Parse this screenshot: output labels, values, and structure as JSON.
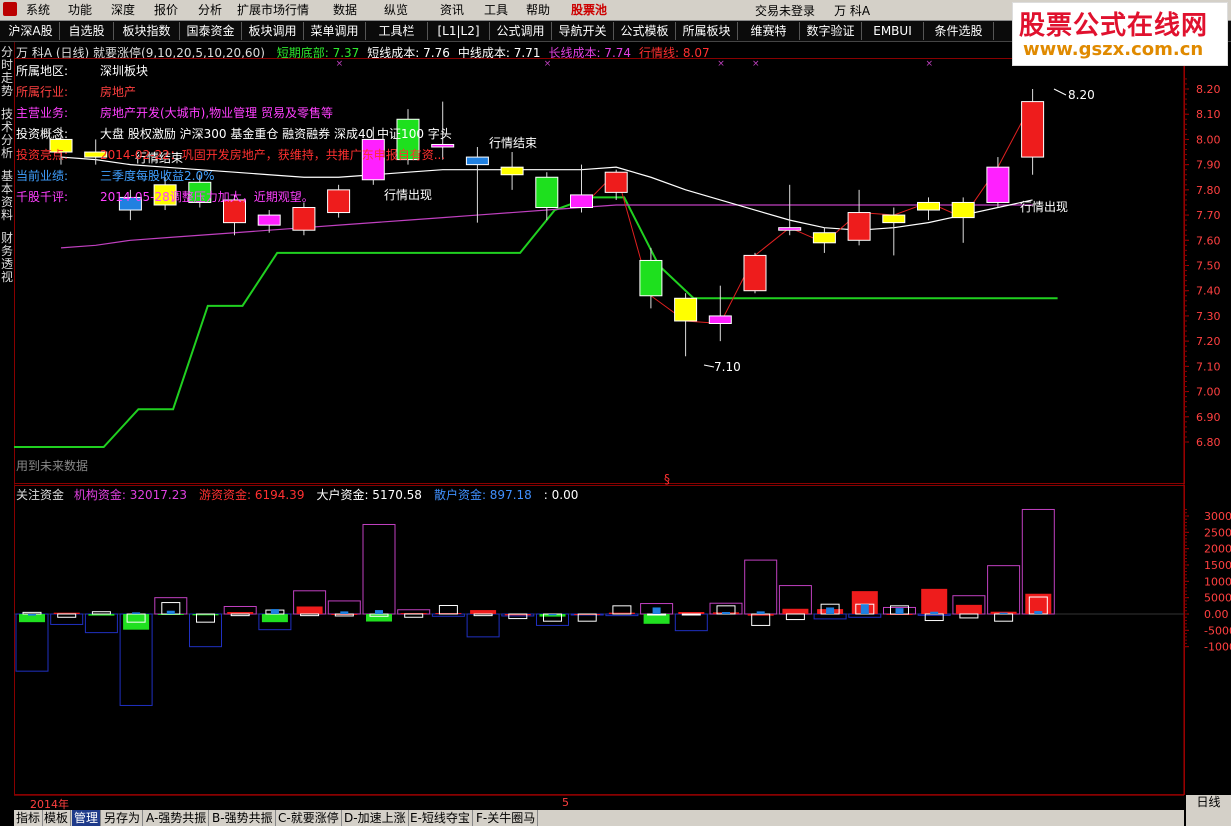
{
  "menubar": {
    "items": [
      "系统",
      "功能",
      "深度",
      "报价",
      "分析",
      "扩展市场行情",
      "数据",
      "纵览",
      "资讯",
      "工具",
      "帮助",
      "股票池"
    ],
    "right": [
      "交易未登录",
      "万 科A"
    ]
  },
  "toolbar": {
    "buttons": [
      "沪深A股",
      "自选股",
      "板块指数",
      "国泰资金",
      "板块调用",
      "菜单调用",
      "工具栏",
      "[L1|L2]",
      "公式调用",
      "导航开关",
      "公式模板",
      "所属板块",
      "维赛特",
      "数字验证",
      "EMBUI",
      "条件选股"
    ]
  },
  "watermark": {
    "line1": "股票公式在线网",
    "line2": "www.gszx.com.cn"
  },
  "sidetabs": [
    "分时走势",
    "技术分析",
    "基本资料",
    "财务透视"
  ],
  "main_header": {
    "stock": "万 科A (日线) 就要涨停(9,10,20,5,10,20,60)",
    "indicators": [
      {
        "label": "短期底部: 7.37",
        "color": "#2ee82e"
      },
      {
        "label": "短线成本: 7.76",
        "color": "#ffffff"
      },
      {
        "label": "中线成本: 7.71",
        "color": "#ffffff"
      },
      {
        "label": "长线成本: 7.74",
        "color": "#e040e0"
      },
      {
        "label": "行情线: 8.07",
        "color": "#ff3030"
      }
    ]
  },
  "info": {
    "rows": [
      {
        "label": "所属地区:",
        "value": "深圳板块",
        "lcolor": "#ffffff",
        "vcolor": "#ffffff"
      },
      {
        "label": "所属行业:",
        "value": "房地产",
        "lcolor": "#ff4040",
        "vcolor": "#ff4040"
      },
      {
        "label": "主营业务:",
        "value": "房地产开发(大城市),物业管理 贸易及零售等",
        "lcolor": "#ff40ff",
        "vcolor": "#ff40ff"
      },
      {
        "label": "投资概念:",
        "value": "大盘 股权激励 沪深300 基金重仓 融资融券 深成40 中证100 字头",
        "lcolor": "#ffffff",
        "vcolor": "#ffffff"
      },
      {
        "label": "投资亮点:",
        "value": "2014-02-22：巩固开发房地产，获维持，共推广东申报自有资...",
        "lcolor": "#ff3030",
        "vcolor": "#ff3030"
      },
      {
        "label": "当前业绩:",
        "value": "三季度每股收益2.0%",
        "lcolor": "#40a0ff",
        "vcolor": "#40a0ff"
      },
      {
        "label": "千股千评:",
        "value": "2014-05-28调整压力加大，近期观望。",
        "lcolor": "#ff40ff",
        "vcolor": "#ff40ff"
      }
    ]
  },
  "annotations": {
    "signal_end_1": "行情结束",
    "signal_end_2": "行情结束",
    "signal_start_1": "行情出现",
    "signal_start_2": "行情出现",
    "high_label": "8.20",
    "low_label": "7.10",
    "future_label": "用到未来数据",
    "dollar": "§"
  },
  "price_axis": [
    "8.20",
    "8.10",
    "8.00",
    "7.90",
    "7.80",
    "7.70",
    "7.60",
    "7.50",
    "7.40",
    "7.30",
    "7.20",
    "7.10",
    "7.00",
    "6.90",
    "6.80"
  ],
  "low_header": {
    "title": "关注资金",
    "items": [
      {
        "label": "机构资金: 32017.23",
        "color": "#e040e0"
      },
      {
        "label": "游资资金: 6194.39",
        "color": "#ff3030"
      },
      {
        "label": "大户资金: 5170.58",
        "color": "#ffffff"
      },
      {
        "label": "散户资金: 897.18",
        "color": "#4090ff"
      },
      {
        "label": ": 0.00",
        "color": "#ffffff"
      }
    ]
  },
  "vol_axis": [
    "30000",
    "25000",
    "20000",
    "15000",
    "10000",
    "5000",
    "0.00",
    "-5000",
    "-10000"
  ],
  "time_axis": {
    "year": "2014年",
    "month": "5"
  },
  "bottom_tabs": [
    "指标",
    "模板",
    "管理",
    "另存为",
    "A-强势共振",
    "B-强势共振",
    "C-就要涨停",
    "D-加速上涨",
    "E-短线夺宝",
    "F-关牛圈马"
  ],
  "period": "日线",
  "colors": {
    "up": "#ff2020",
    "down": "#20e020",
    "ma_white": "#ffffff",
    "ma_magenta": "#c040c0",
    "support": "#20d020",
    "bg": "#000000"
  },
  "chart_data": {
    "type": "candlestick",
    "ylim": [
      6.75,
      8.25
    ],
    "candles": [
      {
        "o": 7.95,
        "c": 8.0,
        "h": 8.05,
        "l": 7.9,
        "col": "yellow"
      },
      {
        "o": 7.93,
        "c": 7.95,
        "h": 8.0,
        "l": 7.9,
        "col": "yellow"
      },
      {
        "o": 7.77,
        "c": 7.72,
        "h": 7.8,
        "l": 7.68,
        "col": "blue"
      },
      {
        "o": 7.82,
        "c": 7.74,
        "h": 7.85,
        "l": 7.72,
        "col": "yellow"
      },
      {
        "o": 7.75,
        "c": 7.83,
        "h": 7.86,
        "l": 7.73,
        "col": "green"
      },
      {
        "o": 7.67,
        "c": 7.76,
        "h": 7.78,
        "l": 7.62,
        "col": "red"
      },
      {
        "o": 7.7,
        "c": 7.66,
        "h": 7.72,
        "l": 7.63,
        "col": "magenta"
      },
      {
        "o": 7.64,
        "c": 7.73,
        "h": 7.75,
        "l": 7.62,
        "col": "red"
      },
      {
        "o": 7.71,
        "c": 7.8,
        "h": 7.82,
        "l": 7.69,
        "col": "red"
      },
      {
        "o": 7.84,
        "c": 8.0,
        "h": 8.05,
        "l": 7.82,
        "col": "magenta"
      },
      {
        "o": 8.08,
        "c": 7.92,
        "h": 8.12,
        "l": 7.9,
        "col": "green"
      },
      {
        "o": 7.97,
        "c": 7.98,
        "h": 8.15,
        "l": 7.92,
        "col": "magenta"
      },
      {
        "o": 7.93,
        "c": 7.9,
        "h": 7.97,
        "l": 7.67,
        "col": "blue"
      },
      {
        "o": 7.86,
        "c": 7.89,
        "h": 7.95,
        "l": 7.8,
        "col": "yellow"
      },
      {
        "o": 7.85,
        "c": 7.73,
        "h": 7.87,
        "l": 7.68,
        "col": "green"
      },
      {
        "o": 7.78,
        "c": 7.73,
        "h": 7.9,
        "l": 7.71,
        "col": "magenta"
      },
      {
        "o": 7.79,
        "c": 7.87,
        "h": 7.88,
        "l": 7.76,
        "col": "red"
      },
      {
        "o": 7.52,
        "c": 7.38,
        "h": 7.57,
        "l": 7.33,
        "col": "green"
      },
      {
        "o": 7.37,
        "c": 7.28,
        "h": 7.39,
        "l": 7.14,
        "col": "yellow"
      },
      {
        "o": 7.3,
        "c": 7.27,
        "h": 7.42,
        "l": 7.2,
        "col": "magenta"
      },
      {
        "o": 7.4,
        "c": 7.54,
        "h": 7.55,
        "l": 7.39,
        "col": "red"
      },
      {
        "o": 7.64,
        "c": 7.65,
        "h": 7.82,
        "l": 7.62,
        "col": "magenta"
      },
      {
        "o": 7.63,
        "c": 7.59,
        "h": 7.65,
        "l": 7.55,
        "col": "yellow"
      },
      {
        "o": 7.6,
        "c": 7.71,
        "h": 7.8,
        "l": 7.58,
        "col": "red"
      },
      {
        "o": 7.67,
        "c": 7.7,
        "h": 7.73,
        "l": 7.54,
        "col": "yellow"
      },
      {
        "o": 7.72,
        "c": 7.75,
        "h": 7.77,
        "l": 7.68,
        "col": "yellow"
      },
      {
        "o": 7.75,
        "c": 7.69,
        "h": 7.77,
        "l": 7.59,
        "col": "yellow"
      },
      {
        "o": 7.75,
        "c": 7.89,
        "h": 7.93,
        "l": 7.73,
        "col": "magenta"
      },
      {
        "o": 7.93,
        "c": 8.15,
        "h": 8.2,
        "l": 7.86,
        "col": "red"
      }
    ],
    "ma_white": [
      7.93,
      7.92,
      7.9,
      7.89,
      7.88,
      7.87,
      7.86,
      7.85,
      7.85,
      7.86,
      7.87,
      7.88,
      7.88,
      7.88,
      7.88,
      7.88,
      7.89,
      7.85,
      7.8,
      7.76,
      7.72,
      7.68,
      7.65,
      7.64,
      7.65,
      7.67,
      7.7,
      7.73,
      7.76
    ],
    "ma_magenta": [
      7.57,
      7.58,
      7.6,
      7.61,
      7.62,
      7.63,
      7.64,
      7.65,
      7.66,
      7.67,
      7.68,
      7.69,
      7.7,
      7.71,
      7.72,
      7.73,
      7.74,
      7.74,
      7.74,
      7.74,
      7.74,
      7.74,
      7.74,
      7.74,
      7.74,
      7.74,
      7.74,
      7.74,
      7.74
    ],
    "support": [
      6.78,
      6.78,
      6.93,
      6.93,
      7.34,
      7.34,
      7.55,
      7.55,
      7.55,
      7.55,
      7.55,
      7.55,
      7.55,
      7.55,
      7.72,
      7.77,
      7.77,
      7.5,
      7.37,
      7.37,
      7.37,
      7.37,
      7.37,
      7.37,
      7.37,
      7.37,
      7.37,
      7.37,
      7.37
    ],
    "flows": [
      {
        "inst": -17500,
        "hot": -2500,
        "big": 500,
        "retail": -500,
        "hot_col": "green"
      },
      {
        "inst": -3200,
        "hot": 400,
        "big": -1000,
        "retail": 0,
        "hot_col": "red"
      },
      {
        "inst": -5700,
        "hot": -500,
        "big": 700,
        "retail": 0,
        "hot_col": "green"
      },
      {
        "inst": -28000,
        "hot": -4800,
        "big": -2500,
        "retail": 500,
        "hot_col": "green"
      },
      {
        "inst": 5000,
        "hot": -300,
        "big": 3500,
        "retail": 1000,
        "hot_col": "green"
      },
      {
        "inst": -10000,
        "hot": -400,
        "big": -2500,
        "retail": 0,
        "hot_col": "green"
      },
      {
        "inst": 2300,
        "hot": 600,
        "big": -500,
        "retail": 0,
        "hot_col": "red"
      },
      {
        "inst": -4800,
        "hot": -2500,
        "big": 1200,
        "retail": 1500,
        "hot_col": "green"
      },
      {
        "inst": 7100,
        "hot": 2300,
        "big": -500,
        "retail": 0,
        "hot_col": "red"
      },
      {
        "inst": 4000,
        "hot": -200,
        "big": -600,
        "retail": 800,
        "hot_col": "red"
      },
      {
        "inst": 27400,
        "hot": -2300,
        "big": -700,
        "retail": 1200,
        "hot_col": "green"
      },
      {
        "inst": 1300,
        "hot": 300,
        "big": -1000,
        "retail": 0,
        "hot_col": "red"
      },
      {
        "inst": -700,
        "hot": 300,
        "big": 2600,
        "retail": 0,
        "hot_col": "red"
      },
      {
        "inst": -7000,
        "hot": 1200,
        "big": -500,
        "retail": 0,
        "hot_col": "red"
      },
      {
        "inst": -600,
        "hot": -400,
        "big": -1400,
        "retail": 0,
        "hot_col": "red"
      },
      {
        "inst": -3500,
        "hot": -800,
        "big": -2200,
        "retail": -400,
        "hot_col": "green"
      },
      {
        "inst": -300,
        "hot": -300,
        "big": -2200,
        "retail": 0,
        "hot_col": "red"
      },
      {
        "inst": -500,
        "hot": 400,
        "big": 2500,
        "retail": 0,
        "hot_col": "red"
      },
      {
        "inst": 3200,
        "hot": -3000,
        "big": -300,
        "retail": 2000,
        "hot_col": "green"
      },
      {
        "inst": -5100,
        "hot": 600,
        "big": -300,
        "retail": 0,
        "hot_col": "red"
      },
      {
        "inst": 3300,
        "hot": 500,
        "big": 2500,
        "retail": 600,
        "hot_col": "red"
      },
      {
        "inst": 16500,
        "hot": -500,
        "big": -3500,
        "retail": 800,
        "hot_col": "red"
      },
      {
        "inst": 8700,
        "hot": 1600,
        "big": -1700,
        "retail": 0,
        "hot_col": "red"
      },
      {
        "inst": -1500,
        "hot": 1500,
        "big": 3000,
        "retail": 2000,
        "hot_col": "red"
      },
      {
        "inst": -1000,
        "hot": 7000,
        "big": 3000,
        "retail": 3000,
        "hot_col": "red"
      },
      {
        "inst": 2000,
        "hot": -100,
        "big": 2500,
        "retail": 1800,
        "hot_col": "red"
      },
      {
        "inst": -400,
        "hot": 7700,
        "big": -2000,
        "retail": 700,
        "hot_col": "red"
      },
      {
        "inst": 5600,
        "hot": 2800,
        "big": -1200,
        "retail": 0,
        "hot_col": "red"
      },
      {
        "inst": 14800,
        "hot": 700,
        "big": -2200,
        "retail": 400,
        "hot_col": "red"
      },
      {
        "inst": 32000,
        "hot": 6200,
        "big": 5200,
        "retail": 900,
        "hot_col": "red"
      }
    ]
  }
}
